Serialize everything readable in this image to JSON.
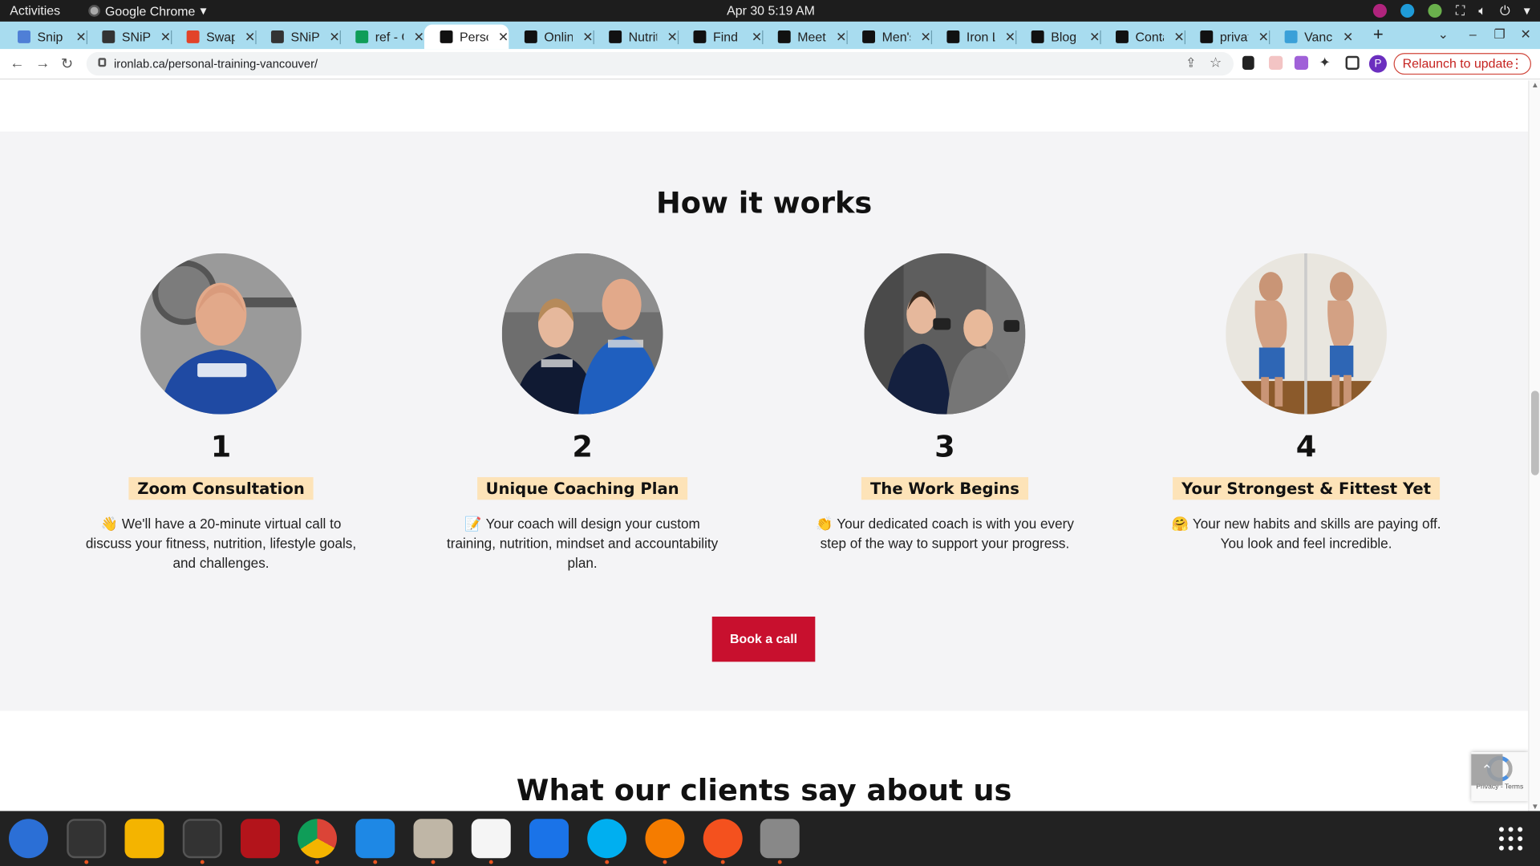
{
  "system": {
    "activities": "Activities",
    "app_name": "Google Chrome",
    "clock": "Apr 30  5:19 AM"
  },
  "browser": {
    "tabs": [
      {
        "title": "Snip D",
        "fav": "#4f7fd6"
      },
      {
        "title": "SNiP N",
        "fav": "#333"
      },
      {
        "title": "Swapr",
        "fav": "#e24329"
      },
      {
        "title": "SNiP N",
        "fav": "#333"
      },
      {
        "title": "ref - G",
        "fav": "#0f9d58"
      },
      {
        "title": "Perso",
        "fav": "#111",
        "active": true
      },
      {
        "title": "Onlin",
        "fav": "#111"
      },
      {
        "title": "Nutrit",
        "fav": "#111"
      },
      {
        "title": "Find o",
        "fav": "#111"
      },
      {
        "title": "Meet I",
        "fav": "#111"
      },
      {
        "title": "Men's",
        "fav": "#111"
      },
      {
        "title": "Iron L",
        "fav": "#111"
      },
      {
        "title": "Blog p",
        "fav": "#111"
      },
      {
        "title": "Conta",
        "fav": "#111"
      },
      {
        "title": "privat",
        "fav": "#111"
      },
      {
        "title": "Vanco",
        "fav": "#3aa0d8"
      }
    ],
    "url": "ironlab.ca/personal-training-vancouver/",
    "relaunch": "Relaunch to update",
    "profile_initial": "P"
  },
  "page": {
    "how_heading": "How it works",
    "steps": [
      {
        "num": "1",
        "title": "Zoom Consultation",
        "emoji": "👋",
        "text": "We'll have a 20-minute virtual call to discuss your fitness, nutrition, lifestyle goals, and challenges."
      },
      {
        "num": "2",
        "title": "Unique Coaching Plan",
        "emoji": "📝",
        "text": "Your coach will design your custom training, nutrition, mindset and accountability plan."
      },
      {
        "num": "3",
        "title": "The Work Begins",
        "emoji": "👏",
        "text": "Your dedicated coach is with you every step of the way to support your progress."
      },
      {
        "num": "4",
        "title": "Your Strongest & Fittest Yet",
        "emoji": "🤗",
        "text": "Your new habits and skills are paying off. You look and feel incredible."
      }
    ],
    "book_button": "Book a call",
    "clients_heading": "What our clients say about us",
    "recaptcha_text": "Privacy - Terms"
  },
  "colors": {
    "accent": "#c8102e",
    "badge": "#fde3b8",
    "band": "#f4f4f6",
    "tabstrip": "#a8dcef"
  }
}
